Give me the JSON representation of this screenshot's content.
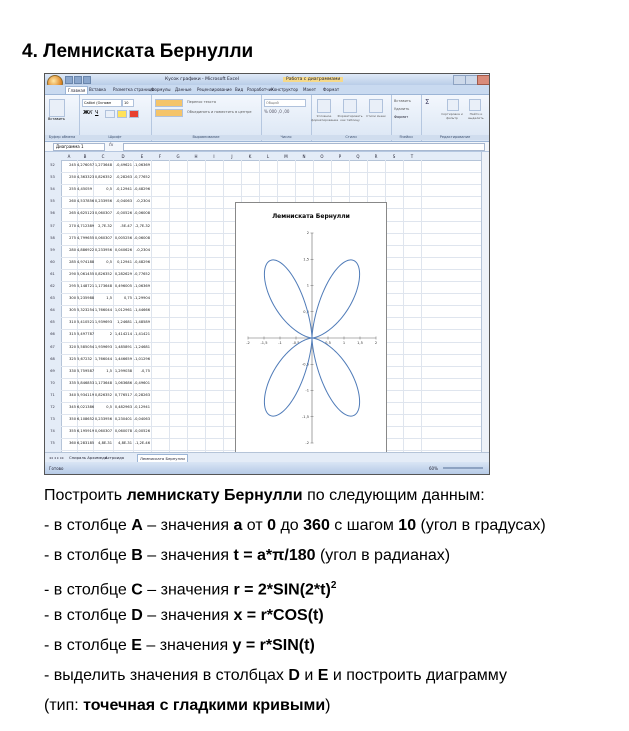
{
  "title": "4. Лемниската Бернулли",
  "excel": {
    "window_title": "Кусок графики - Microsoft Excel",
    "context_title": "Работа с диаграммами",
    "tabs": [
      "Главная",
      "Вставка",
      "Разметка страницы",
      "Формулы",
      "Данные",
      "Рецензирование",
      "Вид",
      "Разработчик",
      "Конструктор",
      "Макет",
      "Формат"
    ],
    "groups": [
      "Буфер обмена",
      "Шрифт",
      "Выравнивание",
      "Число",
      "Стили",
      "Ячейки",
      "Редактирование"
    ],
    "font_name": "Calibri (Основн",
    "font_size": "10",
    "ribbon_labels": {
      "paste": "Вставить",
      "wrap": "Перенос текста",
      "merge": "Объединить и поместить в центре",
      "number_format": "Общий",
      "conditional": "Условное форматирование",
      "format_table": "Форматировать как таблицу",
      "cell_styles": "Стили ячеек",
      "insert": "Вставить",
      "delete": "Удалить",
      "format": "Формат",
      "sort": "Сортировка и фильтр",
      "find": "Найти и выделить"
    },
    "name_box": "Диаграмма 1",
    "fx": "fx",
    "tooltip": "Строка формул",
    "columns": [
      "A",
      "B",
      "C",
      "D",
      "E",
      "F",
      "G",
      "H",
      "I",
      "J",
      "K",
      "L",
      "M",
      "N",
      "O",
      "P",
      "Q",
      "R",
      "S",
      "T"
    ],
    "rows": [
      {
        "n": "52",
        "a": "245",
        "b": "4,276057",
        "c": "1,273648",
        "d": "-0,49621",
        "e": "-1,06369"
      },
      {
        "n": "53",
        "a": "250",
        "b": "4,363323",
        "c": "0,826352",
        "d": "-0,28263",
        "e": "-0,77652"
      },
      {
        "n": "54",
        "a": "255",
        "b": "4,45059",
        "c": "0,5",
        "d": "-0,12941",
        "e": "-0,48296"
      },
      {
        "n": "55",
        "a": "260",
        "b": "4,537856",
        "c": "0,233956",
        "d": "-0,04063",
        "e": "-0,2304"
      },
      {
        "n": "56",
        "a": "265",
        "b": "4,625123",
        "c": "0,060307",
        "d": "-0,00526",
        "e": "-0,06008"
      },
      {
        "n": "57",
        "a": "270",
        "b": "4,712389",
        "c": "2,7E-32",
        "d": "-5E-47",
        "e": "-2,7E-32"
      },
      {
        "n": "58",
        "a": "275",
        "b": "4,799655",
        "c": "0,060307",
        "d": "0,005256",
        "e": "-0,06008"
      },
      {
        "n": "59",
        "a": "280",
        "b": "4,886922",
        "c": "0,233956",
        "d": "0,040626",
        "e": "-0,2304"
      },
      {
        "n": "60",
        "a": "285",
        "b": "4,974188",
        "c": "0,5",
        "d": "0,12941",
        "e": "-0,48296"
      },
      {
        "n": "61",
        "a": "290",
        "b": "5,061455",
        "c": "0,826352",
        "d": "0,282629",
        "e": "-0,77652"
      },
      {
        "n": "62",
        "a": "295",
        "b": "5,148721",
        "c": "1,173648",
        "d": "0,496005",
        "e": "-1,06369"
      },
      {
        "n": "63",
        "a": "300",
        "b": "5,235988",
        "c": "1,5",
        "d": "0,75",
        "e": "-1,29904"
      },
      {
        "n": "64",
        "a": "305",
        "b": "5,323254",
        "c": "1,766044",
        "d": "1,012961",
        "e": "-1,44666"
      },
      {
        "n": "65",
        "a": "310",
        "b": "5,410521",
        "c": "1,939693",
        "d": "1,24681",
        "e": "-1,48589"
      },
      {
        "n": "66",
        "a": "315",
        "b": "5,497787",
        "c": "2",
        "d": "1,414214",
        "e": "-1,41421"
      },
      {
        "n": "67",
        "a": "320",
        "b": "5,585054",
        "c": "1,939693",
        "d": "1,485891",
        "e": "-1,24681"
      },
      {
        "n": "68",
        "a": "325",
        "b": "5,67232",
        "c": "1,766044",
        "d": "1,446659",
        "e": "-1,01296"
      },
      {
        "n": "69",
        "a": "330",
        "b": "5,759587",
        "c": "1,5",
        "d": "1,299038",
        "e": "-0,75"
      },
      {
        "n": "70",
        "a": "335",
        "b": "5,846853",
        "c": "1,173648",
        "d": "1,063686",
        "e": "-0,49601"
      },
      {
        "n": "71",
        "a": "340",
        "b": "5,934119",
        "c": "0,826352",
        "d": "0,776517",
        "e": "-0,28263"
      },
      {
        "n": "72",
        "a": "345",
        "b": "6,021386",
        "c": "0,5",
        "d": "0,482963",
        "e": "-0,12941"
      },
      {
        "n": "73",
        "a": "350",
        "b": "6,108652",
        "c": "0,233956",
        "d": "0,230401",
        "e": "-0,04063"
      },
      {
        "n": "74",
        "a": "355",
        "b": "6,195919",
        "c": "0,060307",
        "d": "0,060078",
        "e": "-0,00526"
      },
      {
        "n": "75",
        "a": "360",
        "b": "6,283185",
        "c": "4,8E-31",
        "d": "4,8E-31",
        "e": "-1,2E-46"
      }
    ],
    "sheet_tabs": [
      "Спираль Архимеда",
      "Астроида",
      "Лемниската Бернулли"
    ],
    "status": "Готово",
    "zoom": "60%"
  },
  "chart_data": {
    "type": "scatter",
    "title": "Лемниската Бернулли",
    "xlim": [
      -2,
      2
    ],
    "ylim": [
      -2,
      2
    ],
    "xticks": [
      "-2",
      "-1,5",
      "-1",
      "-0,5",
      "0",
      "0,5",
      "1",
      "1,5",
      "2"
    ],
    "yticks": [
      "2",
      "1,5",
      "1",
      "0,5",
      "0",
      "-0,5",
      "-1",
      "-1,5",
      "-2"
    ],
    "series": [
      {
        "formula": "r = 2*SIN(2*t)^2, x = r*COS(t), y = r*SIN(t)"
      }
    ],
    "color": "#4f7bb8"
  },
  "instructions": {
    "lines": [
      [
        {
          "t": "Построить "
        },
        {
          "t": "лемнискату Бернулли",
          "b": true
        },
        {
          "t": " по следующим данным:"
        }
      ],
      [
        {
          "t": "- в столбце "
        },
        {
          "t": "A",
          "b": true
        },
        {
          "t": " – значения "
        },
        {
          "t": "a",
          "b": true
        },
        {
          "t": " от "
        },
        {
          "t": "0",
          "b": true
        },
        {
          "t": " до "
        },
        {
          "t": "360",
          "b": true
        },
        {
          "t": " с шагом "
        },
        {
          "t": "10",
          "b": true
        },
        {
          "t": " (угол в градусах)"
        }
      ],
      [
        {
          "t": "- в столбце "
        },
        {
          "t": "B",
          "b": true
        },
        {
          "t": " – значения "
        },
        {
          "t": "t = a*π/180",
          "b": true
        },
        {
          "t": " (угол в радианах)"
        }
      ],
      [
        {
          "t": "- в столбце "
        },
        {
          "t": "C",
          "b": true
        },
        {
          "t": " – значения "
        },
        {
          "t": "r = 2*SIN(2*t)",
          "b": true
        },
        {
          "t": "2",
          "b": true,
          "sup": true
        }
      ],
      [
        {
          "t": "- в столбце "
        },
        {
          "t": "D",
          "b": true
        },
        {
          "t": " – значения "
        },
        {
          "t": "x = r*COS(t)",
          "b": true
        }
      ],
      [
        {
          "t": "- в столбце "
        },
        {
          "t": "E",
          "b": true
        },
        {
          "t": " – значения "
        },
        {
          "t": "y = r*SIN(t)",
          "b": true
        }
      ],
      [
        {
          "t": "- выделить значения в столбцах "
        },
        {
          "t": "D",
          "b": true
        },
        {
          "t": " и "
        },
        {
          "t": "E",
          "b": true
        },
        {
          "t": " и построить диаграмму"
        }
      ],
      [
        {
          "t": "(тип: "
        },
        {
          "t": "точечная с гладкими кривыми",
          "b": true
        },
        {
          "t": ")"
        }
      ]
    ]
  }
}
